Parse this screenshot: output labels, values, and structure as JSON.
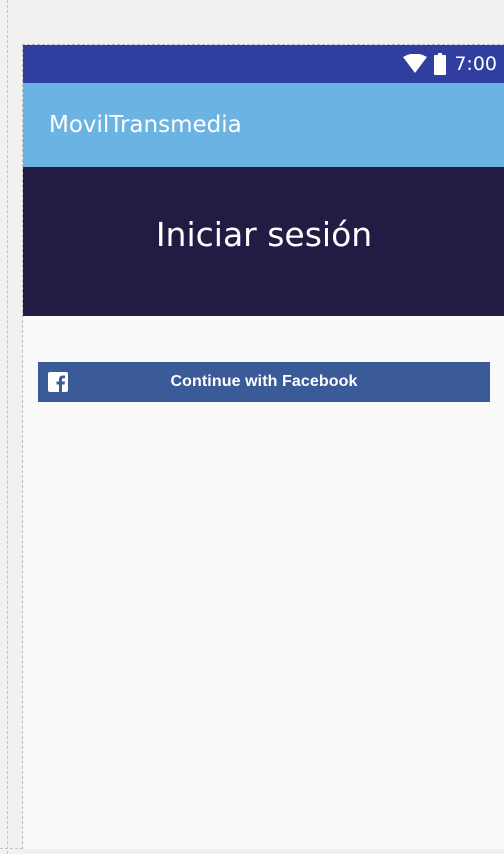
{
  "status_bar": {
    "time": "7:00",
    "icons": [
      "wifi-icon",
      "battery-icon"
    ],
    "color": "#303f9f"
  },
  "app_bar": {
    "title": "MovilTransmedia",
    "color": "#6ab3e2"
  },
  "header": {
    "title": "Iniciar sesión",
    "color": "#221c45"
  },
  "facebook_button": {
    "label": "Continue with Facebook",
    "icon": "facebook-icon",
    "color": "#3b5b98"
  }
}
